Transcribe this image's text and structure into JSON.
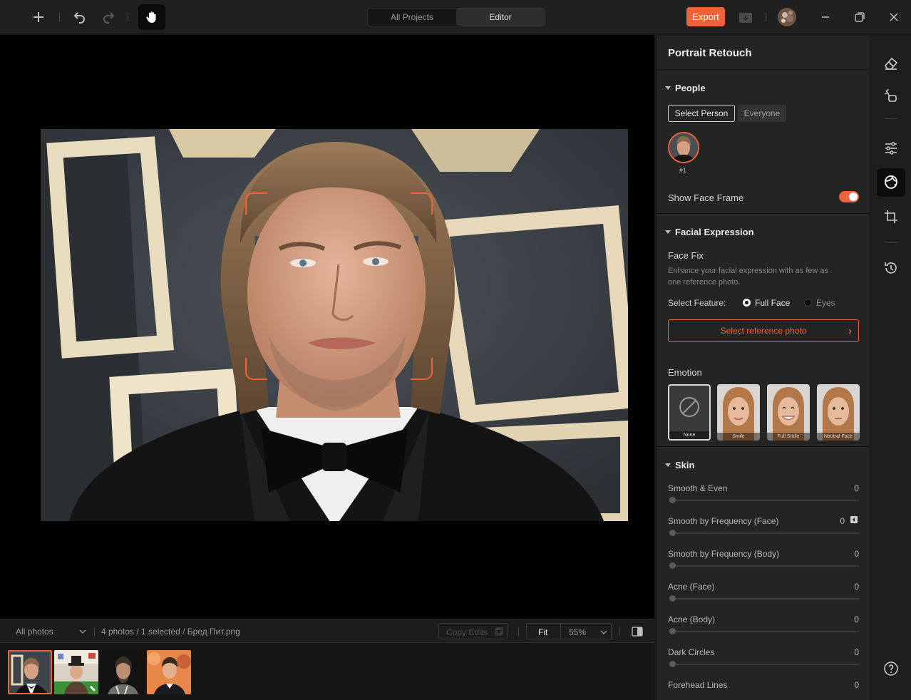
{
  "header": {
    "tabs": [
      {
        "label": "All Projects",
        "active": false
      },
      {
        "label": "Editor",
        "active": true
      }
    ],
    "export_label": "Export",
    "icons": [
      "plus-icon",
      "undo-icon",
      "redo-icon",
      "hand-icon",
      "import-icon",
      "avatar",
      "minimize-icon",
      "restore-icon",
      "close-icon"
    ]
  },
  "bottom": {
    "filter_label": "All photos",
    "status_text": "4 photos / 1 selected / Бред Пит.png",
    "copy_edits_label": "Copy Edits",
    "fit_label": "Fit",
    "zoom_value": "55%",
    "thumbnail_count": 4,
    "selected_thumbnail": 1
  },
  "panel": {
    "title": "Portrait Retouch",
    "people": {
      "heading": "People",
      "select_person_label": "Select Person",
      "everyone_label": "Everyone",
      "person_tag": "#1",
      "show_face_frame_label": "Show Face Frame",
      "show_face_frame_on": true
    },
    "facial_expression": {
      "heading": "Facial Expression",
      "face_fix_label": "Face Fix",
      "face_fix_desc_1": "Enhance your facial expression with as few as",
      "face_fix_desc_2": "one reference photo.",
      "select_feature_label": "Select Feature:",
      "options": [
        "Full Face",
        "Eyes"
      ],
      "selected_option": "Full Face",
      "ref_button_label": "Select reference photo",
      "emotion_label": "Emotion",
      "emotions": [
        "None",
        "Smile",
        "Full Smile",
        "Neutral Face"
      ],
      "selected_emotion": "None"
    },
    "skin": {
      "heading": "Skin",
      "sliders": [
        {
          "label": "Smooth & Even",
          "value": "0"
        },
        {
          "label": "Smooth by Frequency (Face)",
          "value": "0"
        },
        {
          "label": "Smooth by Frequency (Body)",
          "value": "0"
        },
        {
          "label": "Acne (Face)",
          "value": "0"
        },
        {
          "label": "Acne (Body)",
          "value": "0"
        },
        {
          "label": "Dark Circles",
          "value": "0"
        },
        {
          "label": "Forehead Lines",
          "value": "0"
        }
      ]
    }
  },
  "rail": {
    "icons": [
      "eraser-icon",
      "magic-brush-icon",
      "adjustments-icon",
      "portrait-retouch-icon",
      "crop-icon",
      "history-icon",
      "help-icon"
    ],
    "active": "portrait-retouch-icon"
  },
  "colors": {
    "accent": "#f0623a",
    "panel_bg": "#242424",
    "canvas_bg": "#000000"
  }
}
